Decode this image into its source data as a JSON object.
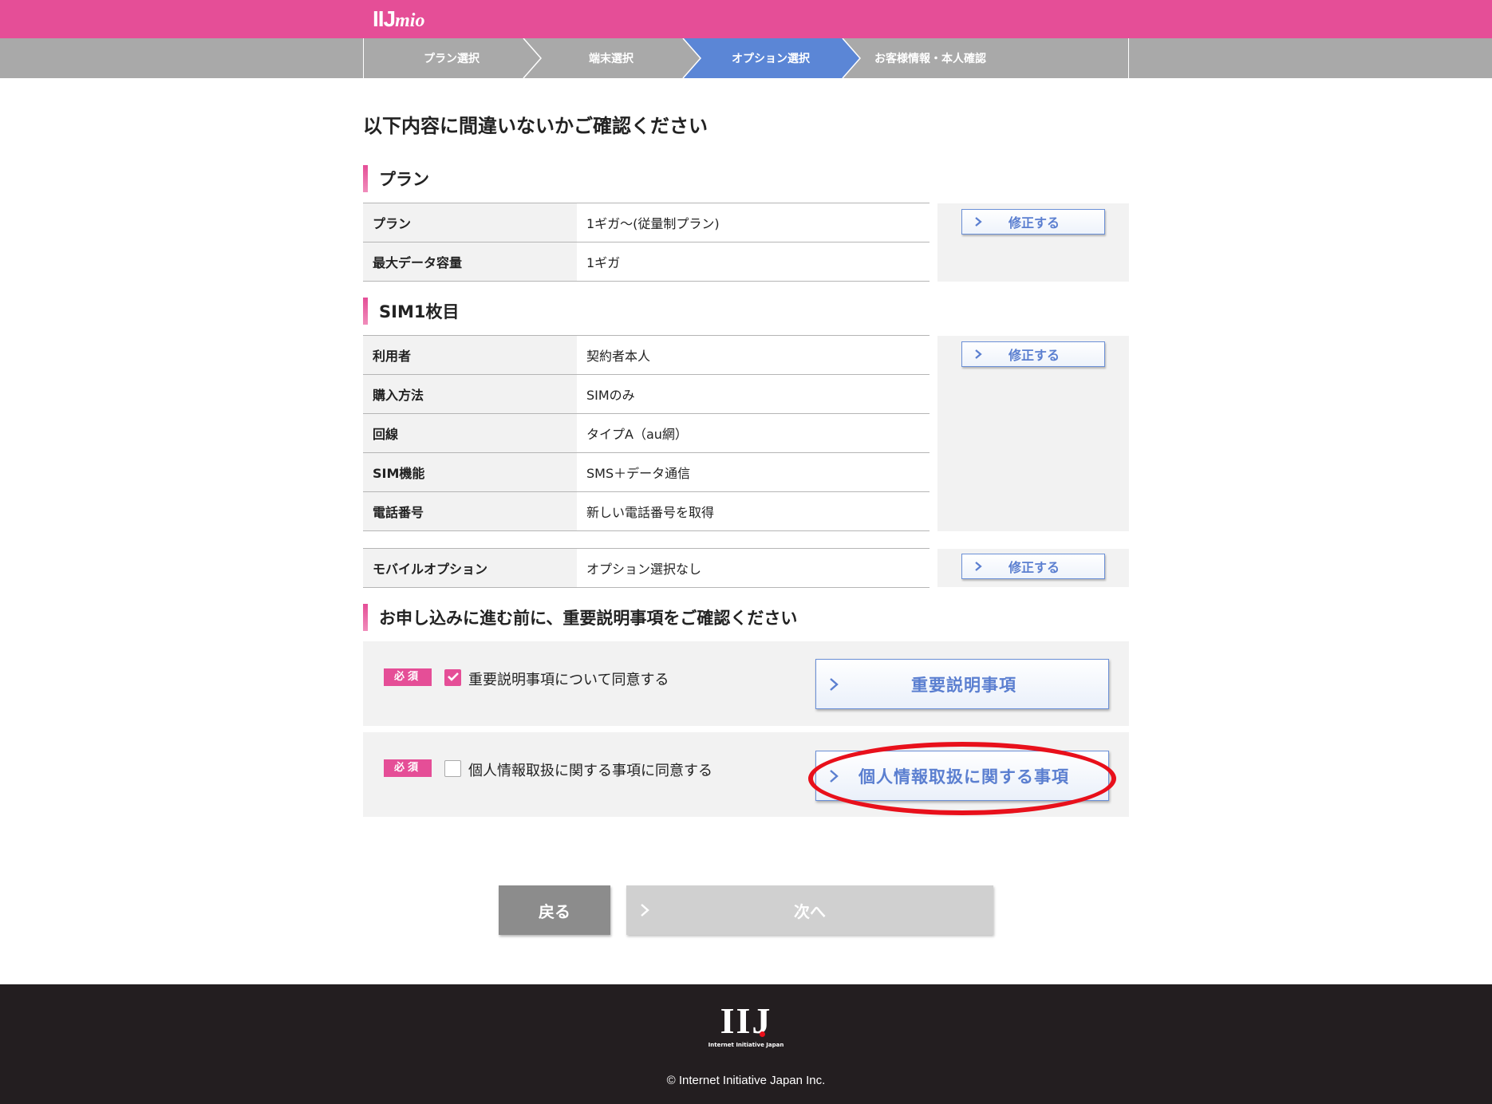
{
  "header": {
    "logo_main": "IIJ",
    "logo_sub": "mio",
    "brand_color": "#e54e97"
  },
  "steps": [
    {
      "label": "プラン選択",
      "active": false
    },
    {
      "label": "端末選択",
      "active": false
    },
    {
      "label": "オプション選択",
      "active": true
    },
    {
      "label": "お客様情報・本人確認",
      "active": false
    }
  ],
  "page_title": "以下内容に間違いないかご確認ください",
  "plan_section": {
    "heading": "プラン",
    "rows": [
      {
        "label": "プラン",
        "value": "1ギガ〜(従量制プラン)"
      },
      {
        "label": "最大データ容量",
        "value": "1ギガ"
      }
    ],
    "edit_label": "修正する"
  },
  "sim_section": {
    "heading": "SIM1枚目",
    "rows": [
      {
        "label": "利用者",
        "value": "契約者本人"
      },
      {
        "label": "購入方法",
        "value": "SIMのみ"
      },
      {
        "label": "回線",
        "value": "タイプA（au網）"
      },
      {
        "label": "SIM機能",
        "value": "SMS＋データ通信"
      },
      {
        "label": "電話番号",
        "value": "新しい電話番号を取得"
      }
    ],
    "edit_label": "修正する"
  },
  "mobile_option": {
    "label": "モバイルオプション",
    "value": "オプション選択なし",
    "edit_label": "修正する"
  },
  "important_section": {
    "heading": "お申し込みに進む前に、重要説明事項をご確認ください",
    "items": [
      {
        "badge": "必須",
        "checked": true,
        "label": "重要説明事項について同意する",
        "button": "重要説明事項"
      },
      {
        "badge": "必須",
        "checked": false,
        "label": "個人情報取扱に関する事項に同意する",
        "button": "個人情報取扱に関する事項"
      }
    ]
  },
  "nav": {
    "back": "戻る",
    "next": "次へ"
  },
  "footer": {
    "logo": "IIJ",
    "logo_sub": "Internet Initiative Japan",
    "copyright": "© Internet Initiative Japan Inc."
  },
  "icons": [
    "chevron-right-icon",
    "check-icon"
  ],
  "colors": {
    "accent": "#e54e97",
    "step_active": "#5b86d6",
    "button_text": "#5b7fd0",
    "annotation": "#e8101b"
  }
}
